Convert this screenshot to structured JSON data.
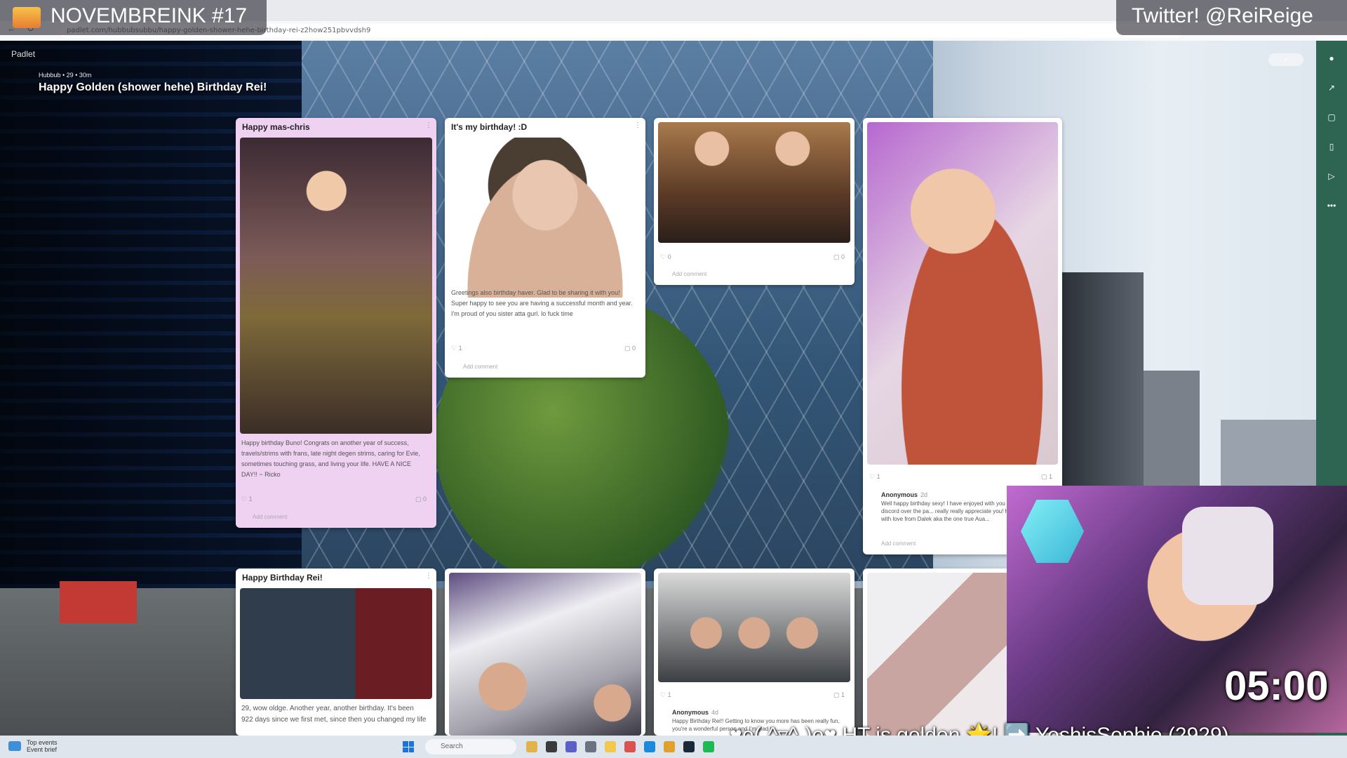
{
  "stream": {
    "title": "NOVEMBREINK #17",
    "twitter": "Twitter! @ReiReige",
    "timer": "05:00",
    "ticker": "♥o(„^▿^„)o♥ HT is golden 🌟! ➡️ YoshisSophie (2929)"
  },
  "browser": {
    "url": "padlet.com/hubbubsubbu/happy-golden-shower-hehe-birthday-rei-z2how251pbvvdsh9"
  },
  "padlet": {
    "brand": "Padlet",
    "meta": "Hubbub • 29 • 30m",
    "board_title": "Happy Golden (shower hehe) Birthday Rei!"
  },
  "cards": [
    {
      "title": "Happy mas-chris",
      "text": "Happy birthday Buno! Congrats on another year of success, travels/strims with frans, late night degen strims, caring for Evie, sometimes touching grass, and living your life. HAVE A NICE DAY!! ~ Ricko",
      "likes": "1",
      "comments": "0",
      "add_comment": "Add comment"
    },
    {
      "title": "It's my birthday! :D",
      "text": "Greetings also birthday haver. Glad to be sharing it with you! Super happy to see you are having a successful month and year. I'm proud of you sister atta gurl. lo fuck time",
      "likes": "1",
      "comments": "0",
      "add_comment": "Add comment"
    },
    {
      "title": "",
      "likes": "0",
      "comments": "0",
      "add_comment": "Add comment"
    },
    {
      "title": "",
      "author": "Anonymous",
      "time": "2d",
      "text": "Well happy birthday sexy! I have enjoyed with you on MFC and discord over the pa... really really appreciate you! Have an awes... with love from Dalek aka the one true Aua...",
      "likes": "1",
      "comments": "1",
      "add_comment": "Add comment"
    },
    {
      "title": "Happy Birthday Rei!",
      "text": "29, wow oldge. Another year, another birthday. It's been 922 days since we first met, since then you changed my life"
    },
    {
      "title": ""
    },
    {
      "title": "",
      "author": "Anonymous",
      "time": "4d",
      "text": "Happy Birthday Rei!! Getting to know you more has been really fun, you're a wonderful person and I'm glad to...",
      "likes": "1",
      "comments": "1"
    },
    {
      "title": ""
    }
  ],
  "taskbar": {
    "weather_title": "Top events",
    "weather_sub": "Event brief",
    "search": "Search"
  },
  "icons": {
    "like": "heart-icon",
    "comment": "comment-icon",
    "menu": "kebab-menu-icon"
  }
}
